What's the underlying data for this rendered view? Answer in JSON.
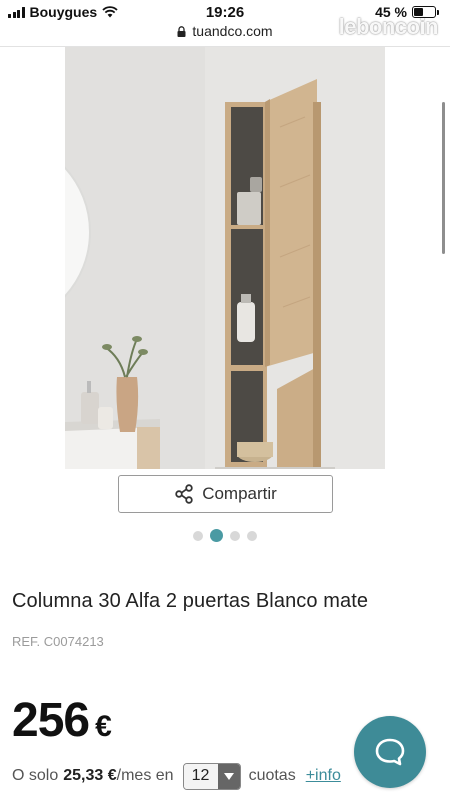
{
  "status_bar": {
    "carrier": "Bouygues",
    "time": "19:26",
    "battery_percent": "45 %",
    "battery_level": 0.45
  },
  "browser": {
    "url": "tuandco.com"
  },
  "watermark": "leboncoin",
  "gallery": {
    "share_label": "Compartir",
    "dot_count": 4,
    "active_dot": 1
  },
  "product": {
    "title": "Columna 30 Alfa 2 puertas Blanco mate",
    "ref": "REF. C0074213",
    "price": "256",
    "currency": "€"
  },
  "financing": {
    "prefix": "O solo",
    "monthly_amount": "25,33 €",
    "per_month": "/mes en",
    "months_selected": "12",
    "installments_label": "cuotas",
    "info_link": "+info"
  },
  "colors": {
    "accent": "#3e8b97",
    "link": "#3c8c9a",
    "active_dot": "#4a9aa3"
  },
  "icons": {
    "share": "share-icon",
    "chat": "chat-bubble-icon",
    "lock": "lock-icon",
    "wifi": "wifi-icon"
  }
}
